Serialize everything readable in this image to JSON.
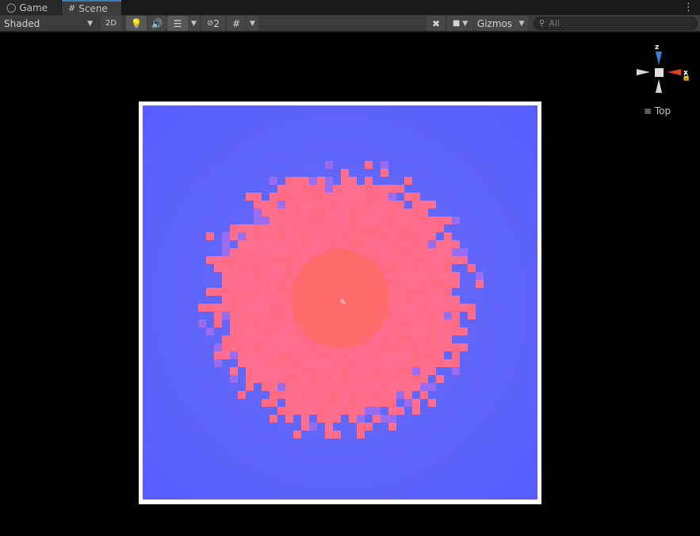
{
  "tabs": [
    {
      "label": "Game",
      "active": false
    },
    {
      "label": "Scene",
      "active": true
    }
  ],
  "toolbar": {
    "shading_mode": "Shaded",
    "mode_2d": "2D",
    "hidden_count": "2",
    "gizmos_label": "Gizmos",
    "search_placeholder": "All"
  },
  "gizmo": {
    "axis_z": "z",
    "axis_x": "x",
    "view_label": "Top"
  },
  "colors": {
    "background_plane": "#5d62fb",
    "blob": "#ff6e8c",
    "blob_core": "#ff6a6a",
    "frame": "#ffffff",
    "tab_accent": "#3a79bb",
    "gizmo_z": "#3a7fe0",
    "gizmo_x": "#e2401c"
  },
  "icons": [
    "gamepad-icon",
    "grid-icon",
    "menu-dots-icon",
    "lightbulb-icon",
    "audio-icon",
    "effects-icon",
    "visibility-icon",
    "snap-grid-icon",
    "tools-icon",
    "camera-icon",
    "search-icon",
    "lock-icon",
    "hamburger-icon"
  ]
}
